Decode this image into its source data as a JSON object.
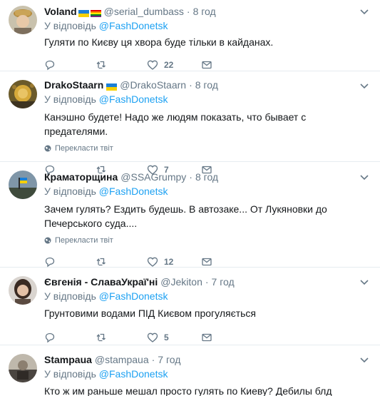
{
  "reply_prefix": "У відповідь ",
  "translate_label": "Перекласти твіт",
  "tweets": [
    {
      "name": "Voland",
      "handle": "@serial_dumbass",
      "time": "8 год",
      "reply_to": "@FashDonetsk",
      "text": "Гуляти по Києву ця хвора буде тільки в кайданах.",
      "likes": "22"
    },
    {
      "name": "DrakoStaarn",
      "handle": "@DrakoStaarn",
      "time": "8 год",
      "reply_to": "@FashDonetsk",
      "text": "Канэшно будете! Надо же людям показать, что бывает с предателями.",
      "likes": "7"
    },
    {
      "name": "Краматорщина",
      "handle": "@SSAGrumpy",
      "time": "8 год",
      "reply_to": "@FashDonetsk",
      "text": "Зачем гулять? Ездить будешь. В автозаке... От Лукяновки до Печерського суда....",
      "likes": "12"
    },
    {
      "name": "Євгенія - СлаваУкраї'ні",
      "handle": "@Jekiton",
      "time": "7 год",
      "reply_to": "@FashDonetsk",
      "text": "Грунтовими водами ПІД Києвом прогуляється",
      "likes": "5"
    },
    {
      "name": "Stampaua",
      "handle": "@stampaua",
      "time": "7 год",
      "reply_to": "@FashDonetsk",
      "text": "Кто ж им раньше мешал просто гулять по Киеву? Дебилы блд"
    }
  ]
}
